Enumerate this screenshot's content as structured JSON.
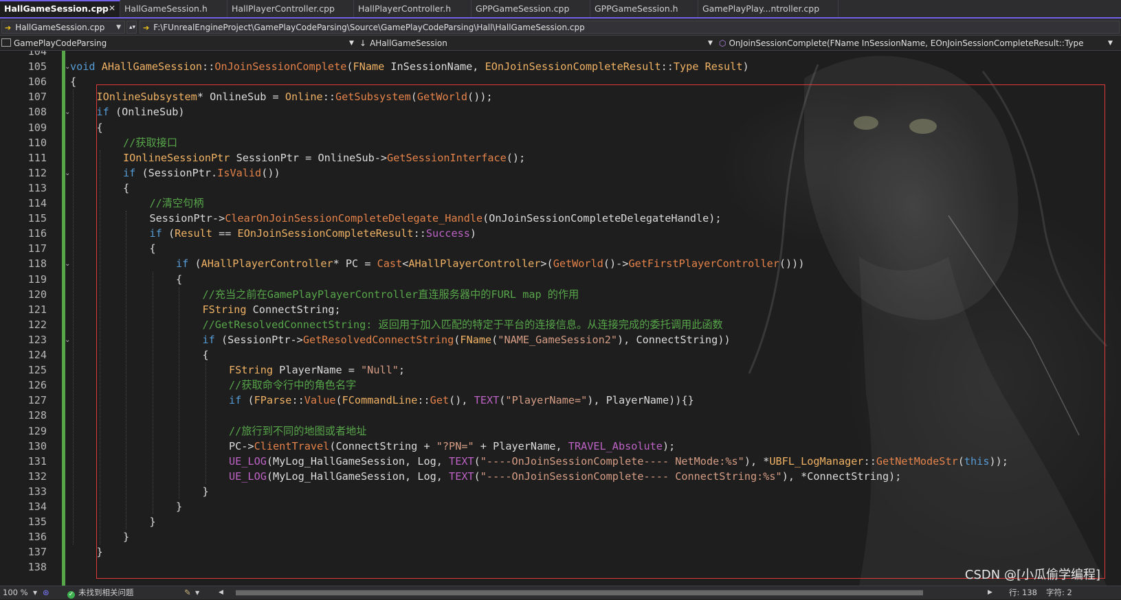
{
  "tabs": [
    {
      "label": "HallGameSession.cpp",
      "active": true,
      "pin_icon": "pin-icon",
      "close_icon": "close-icon"
    },
    {
      "label": "HallGameSession.h",
      "active": false
    },
    {
      "label": "HallPlayerController.cpp",
      "active": false
    },
    {
      "label": "HallPlayerController.h",
      "active": false
    },
    {
      "label": "GPPGameSession.cpp",
      "active": false
    },
    {
      "label": "GPPGameSession.h",
      "active": false
    },
    {
      "label": "GamePlayPlay...ntroller.cpp",
      "active": false
    }
  ],
  "pathbar": {
    "file_dropdown": "HallGameSession.cpp",
    "full_path": "F:\\FUnrealEngineProject\\GamePlayCodeParsing\\Source\\GamePlayCodeParsing\\Hall\\HallGameSession.cpp"
  },
  "navbar": {
    "project": "GamePlayCodeParsing",
    "class_scope": "AHallGameSession",
    "member": "OnJoinSessionComplete(FName InSessionName, EOnJoinSessionCompleteResult::Type"
  },
  "editor": {
    "line_numbers": [
      "104",
      "105",
      "106",
      "107",
      "108",
      "109",
      "110",
      "111",
      "112",
      "113",
      "114",
      "115",
      "116",
      "117",
      "118",
      "119",
      "120",
      "121",
      "122",
      "123",
      "124",
      "125",
      "126",
      "127",
      "128",
      "129",
      "130",
      "131",
      "132",
      "133",
      "134",
      "135",
      "136",
      "137",
      "138"
    ],
    "code_lines": [
      {
        "ln": "105",
        "indent": 0,
        "tokens": [
          [
            "kw",
            "void"
          ],
          [
            "pl",
            " "
          ],
          [
            "ty",
            "AHallGameSession"
          ],
          [
            "pl",
            "::"
          ],
          [
            "fn",
            "OnJoinSessionComplete"
          ],
          [
            "pl",
            "("
          ],
          [
            "ty",
            "FName"
          ],
          [
            "pl",
            " InSessionName, "
          ],
          [
            "ty",
            "EOnJoinSessionCompleteResult"
          ],
          [
            "pl",
            "::"
          ],
          [
            "ty",
            "Type"
          ],
          [
            "pl",
            " "
          ],
          [
            "ty",
            "Result"
          ],
          [
            "pl",
            ")"
          ]
        ]
      },
      {
        "ln": "106",
        "indent": 0,
        "tokens": [
          [
            "pl",
            "{"
          ]
        ]
      },
      {
        "ln": "107",
        "indent": 1,
        "tokens": [
          [
            "ty",
            "IOnlineSubsystem"
          ],
          [
            "pl",
            "* OnlineSub = "
          ],
          [
            "ty",
            "Online"
          ],
          [
            "pl",
            "::"
          ],
          [
            "fn",
            "GetSubsystem"
          ],
          [
            "pl",
            "("
          ],
          [
            "fn",
            "GetWorld"
          ],
          [
            "pl",
            "());"
          ]
        ]
      },
      {
        "ln": "108",
        "indent": 1,
        "tokens": [
          [
            "kw",
            "if"
          ],
          [
            "pl",
            " (OnlineSub)"
          ]
        ]
      },
      {
        "ln": "109",
        "indent": 1,
        "tokens": [
          [
            "pl",
            "{"
          ]
        ]
      },
      {
        "ln": "110",
        "indent": 2,
        "tokens": [
          [
            "cm",
            "//获取接口"
          ]
        ]
      },
      {
        "ln": "111",
        "indent": 2,
        "tokens": [
          [
            "ty",
            "IOnlineSessionPtr"
          ],
          [
            "pl",
            " SessionPtr = OnlineSub->"
          ],
          [
            "fn",
            "GetSessionInterface"
          ],
          [
            "pl",
            "();"
          ]
        ]
      },
      {
        "ln": "112",
        "indent": 2,
        "tokens": [
          [
            "kw",
            "if"
          ],
          [
            "pl",
            " (SessionPtr."
          ],
          [
            "fn",
            "IsValid"
          ],
          [
            "pl",
            "())"
          ]
        ]
      },
      {
        "ln": "113",
        "indent": 2,
        "tokens": [
          [
            "pl",
            "{"
          ]
        ]
      },
      {
        "ln": "114",
        "indent": 3,
        "tokens": [
          [
            "cm",
            "//清空句柄"
          ]
        ]
      },
      {
        "ln": "115",
        "indent": 3,
        "tokens": [
          [
            "pl",
            "SessionPtr->"
          ],
          [
            "fn",
            "ClearOnJoinSessionCompleteDelegate_Handle"
          ],
          [
            "pl",
            "(OnJoinSessionCompleteDelegateHandle);"
          ]
        ]
      },
      {
        "ln": "116",
        "indent": 3,
        "tokens": [
          [
            "kw",
            "if"
          ],
          [
            "pl",
            " ("
          ],
          [
            "ty",
            "Result"
          ],
          [
            "pl",
            " == "
          ],
          [
            "ty",
            "EOnJoinSessionCompleteResult"
          ],
          [
            "pl",
            "::"
          ],
          [
            "mac",
            "Success"
          ],
          [
            "pl",
            ")"
          ]
        ]
      },
      {
        "ln": "117",
        "indent": 3,
        "tokens": [
          [
            "pl",
            "{"
          ]
        ]
      },
      {
        "ln": "118",
        "indent": 4,
        "tokens": [
          [
            "kw",
            "if"
          ],
          [
            "pl",
            " ("
          ],
          [
            "ty",
            "AHallPlayerController"
          ],
          [
            "pl",
            "* PC = "
          ],
          [
            "fn",
            "Cast"
          ],
          [
            "pl",
            "<"
          ],
          [
            "ty",
            "AHallPlayerController"
          ],
          [
            "pl",
            ">("
          ],
          [
            "fn",
            "GetWorld"
          ],
          [
            "pl",
            "()->"
          ],
          [
            "fn",
            "GetFirstPlayerController"
          ],
          [
            "pl",
            "()))"
          ]
        ]
      },
      {
        "ln": "119",
        "indent": 4,
        "tokens": [
          [
            "pl",
            "{"
          ]
        ]
      },
      {
        "ln": "120",
        "indent": 5,
        "tokens": [
          [
            "cm",
            "//充当之前在GamePlayPlayerController直连服务器中的FURL map 的作用"
          ]
        ]
      },
      {
        "ln": "121",
        "indent": 5,
        "tokens": [
          [
            "ty",
            "FString"
          ],
          [
            "pl",
            " ConnectString;"
          ]
        ]
      },
      {
        "ln": "122",
        "indent": 5,
        "tokens": [
          [
            "cm",
            "//GetResolvedConnectString: 返回用于加入匹配的特定于平台的连接信息。从连接完成的委托调用此函数"
          ]
        ]
      },
      {
        "ln": "123",
        "indent": 5,
        "tokens": [
          [
            "kw",
            "if"
          ],
          [
            "pl",
            " (SessionPtr->"
          ],
          [
            "fn",
            "GetResolvedConnectString"
          ],
          [
            "pl",
            "("
          ],
          [
            "ty",
            "FName"
          ],
          [
            "pl",
            "("
          ],
          [
            "st",
            "\"NAME_GameSession2\""
          ],
          [
            "pl",
            "), ConnectString))"
          ]
        ]
      },
      {
        "ln": "124",
        "indent": 5,
        "tokens": [
          [
            "pl",
            "{"
          ]
        ]
      },
      {
        "ln": "125",
        "indent": 6,
        "tokens": [
          [
            "ty",
            "FString"
          ],
          [
            "pl",
            " PlayerName = "
          ],
          [
            "st",
            "\"Null\""
          ],
          [
            "pl",
            ";"
          ]
        ]
      },
      {
        "ln": "126",
        "indent": 6,
        "tokens": [
          [
            "cm",
            "//获取命令行中的角色名字"
          ]
        ]
      },
      {
        "ln": "127",
        "indent": 6,
        "tokens": [
          [
            "kw",
            "if"
          ],
          [
            "pl",
            " ("
          ],
          [
            "ty",
            "FParse"
          ],
          [
            "pl",
            "::"
          ],
          [
            "fn",
            "Value"
          ],
          [
            "pl",
            "("
          ],
          [
            "ty",
            "FCommandLine"
          ],
          [
            "pl",
            "::"
          ],
          [
            "fn",
            "Get"
          ],
          [
            "pl",
            "(), "
          ],
          [
            "mac",
            "TEXT"
          ],
          [
            "pl",
            "("
          ],
          [
            "st",
            "\"PlayerName=\""
          ],
          [
            "pl",
            "), PlayerName)){}"
          ]
        ]
      },
      {
        "ln": "128",
        "indent": 6,
        "tokens": []
      },
      {
        "ln": "129",
        "indent": 6,
        "tokens": [
          [
            "cm",
            "//旅行到不同的地图或者地址"
          ]
        ]
      },
      {
        "ln": "130",
        "indent": 6,
        "tokens": [
          [
            "pl",
            "PC->"
          ],
          [
            "fn",
            "ClientTravel"
          ],
          [
            "pl",
            "(ConnectString + "
          ],
          [
            "st",
            "\"?PN=\""
          ],
          [
            "pl",
            " + PlayerName, "
          ],
          [
            "mac",
            "TRAVEL_Absolute"
          ],
          [
            "pl",
            ");"
          ]
        ]
      },
      {
        "ln": "131",
        "indent": 6,
        "tokens": [
          [
            "mac",
            "UE_LOG"
          ],
          [
            "pl",
            "(MyLog_HallGameSession, Log, "
          ],
          [
            "mac",
            "TEXT"
          ],
          [
            "pl",
            "("
          ],
          [
            "st",
            "\"----OnJoinSessionComplete---- NetMode:%s\""
          ],
          [
            "pl",
            "), *"
          ],
          [
            "ty",
            "UBFL_LogManager"
          ],
          [
            "pl",
            "::"
          ],
          [
            "fn",
            "GetNetModeStr"
          ],
          [
            "pl",
            "("
          ],
          [
            "kw",
            "this"
          ],
          [
            "pl",
            "));"
          ]
        ]
      },
      {
        "ln": "132",
        "indent": 6,
        "tokens": [
          [
            "mac",
            "UE_LOG"
          ],
          [
            "pl",
            "(MyLog_HallGameSession, Log, "
          ],
          [
            "mac",
            "TEXT"
          ],
          [
            "pl",
            "("
          ],
          [
            "st",
            "\"----OnJoinSessionComplete---- ConnectString:%s\""
          ],
          [
            "pl",
            "), *ConnectString);"
          ]
        ]
      },
      {
        "ln": "133",
        "indent": 5,
        "tokens": [
          [
            "pl",
            "}"
          ]
        ]
      },
      {
        "ln": "134",
        "indent": 4,
        "tokens": [
          [
            "pl",
            "}"
          ]
        ]
      },
      {
        "ln": "135",
        "indent": 3,
        "tokens": [
          [
            "pl",
            "}"
          ]
        ]
      },
      {
        "ln": "136",
        "indent": 2,
        "tokens": [
          [
            "pl",
            "}"
          ]
        ]
      },
      {
        "ln": "137",
        "indent": 1,
        "tokens": [
          [
            "pl",
            "}"
          ]
        ]
      }
    ],
    "fold_lines": [
      "105",
      "108",
      "112",
      "118",
      "123"
    ],
    "watermark": "CSDN @[小瓜偷学编程]"
  },
  "statusbar": {
    "zoom": "100 %",
    "issues": "未找到相关问题",
    "position": "行: 138",
    "column": "字符: 2",
    "ok_icon": "check-circle-icon",
    "brush_icon": "brush-icon"
  },
  "colors": {
    "accent": "#7160e8",
    "highlight_box": "#e23a3a",
    "change_bar": "#57a64a",
    "keyword": "#569cd6",
    "type": "#f0b264",
    "function": "#e5834a",
    "comment": "#57a64a",
    "string": "#d69d85",
    "macro": "#bd63c5"
  }
}
